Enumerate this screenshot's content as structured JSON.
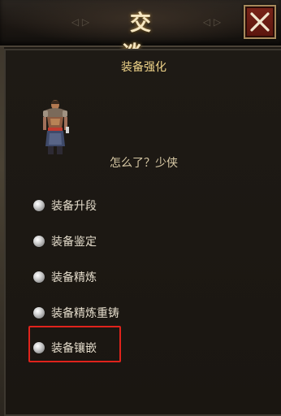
{
  "window": {
    "title": "交 谈",
    "close_icon": "close-icon"
  },
  "npc": {
    "name": "装备强化",
    "portrait_icon": "npc-portrait-icon",
    "dialogue": "怎么了？少侠"
  },
  "options": [
    {
      "label": "装备升段",
      "icon": "bullet-icon"
    },
    {
      "label": "装备鉴定",
      "icon": "bullet-icon"
    },
    {
      "label": "装备精炼",
      "icon": "bullet-icon"
    },
    {
      "label": "装备精炼重铸",
      "icon": "bullet-icon"
    },
    {
      "label": "装备镶嵌",
      "icon": "bullet-icon",
      "highlighted": true
    }
  ],
  "colors": {
    "title": "#f6e7c2",
    "npc_name": "#f1d58a",
    "dialogue": "#d8c9a5",
    "option_text": "#e4dccb",
    "highlight_border": "#e0231c",
    "close_button_bg": "#7a2419"
  }
}
